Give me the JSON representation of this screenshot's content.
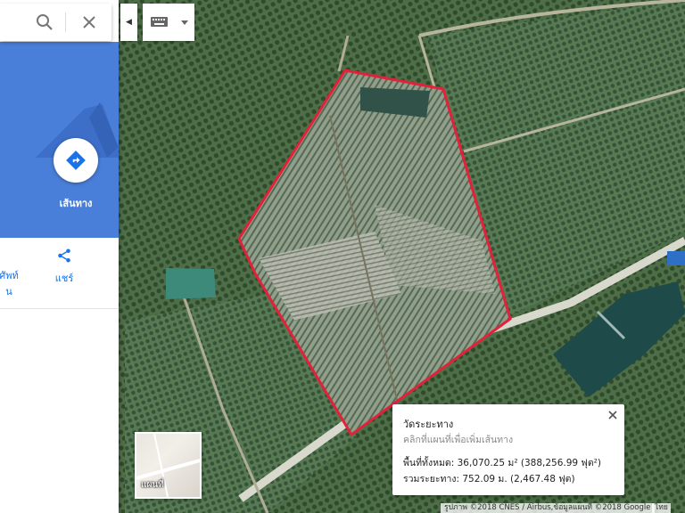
{
  "search": {
    "value": "",
    "placeholder": ""
  },
  "panel": {
    "directions_label": "เส้นทาง",
    "actions": [
      {
        "label_line1": "ศัพท์",
        "label_line2": "น"
      },
      {
        "label_line1": "แชร์",
        "label_line2": ""
      }
    ]
  },
  "layer_switch": {
    "label": "แผนที่"
  },
  "measure": {
    "title": "วัดระยะทาง",
    "subtitle": "คลิกที่แผนที่เพื่อเพิ่มเส้นทาง",
    "area_label": "พื้นที่ทั้งหมด:",
    "area_value": "36,070.25 ม² (388,256.99 ฟุต²)",
    "distance_label": "รวมระยะทาง:",
    "distance_value": "752.09 ม. (2,467.48 ฟุต)"
  },
  "attribution": {
    "text": "รูปภาพ ©2018 CNES / Airbus,ข้อมูลแผนที่ ©2018 Google",
    "terms": "ไทย"
  },
  "colors": {
    "accent": "#4a7fd9",
    "polygon": "#e2213a",
    "link": "#1a73e8"
  }
}
